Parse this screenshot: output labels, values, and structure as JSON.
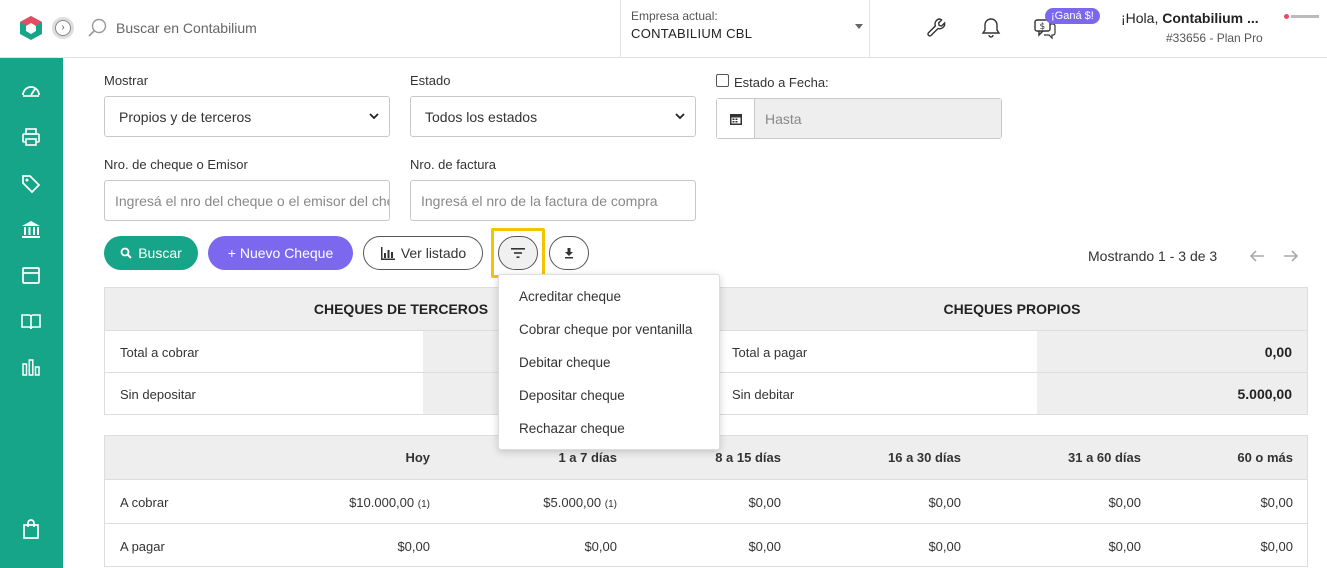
{
  "topbar": {
    "search_placeholder": "Buscar en Contabilium",
    "company_label": "Empresa actual:",
    "company_value": "CONTABILIUM CBL",
    "promo_badge": "¡Ganá $!",
    "greeting_prefix": "¡Hola, ",
    "greeting_name": "Contabilium ...",
    "plan": "#33656 - Plan Pro"
  },
  "sidebar": {
    "icons": [
      "dashboard-icon",
      "printer-icon",
      "tag-icon",
      "bank-icon",
      "box-icon",
      "book-icon",
      "bar-chart-icon",
      "shopping-bag-icon"
    ],
    "color": "#17a589"
  },
  "filters": {
    "mostrar_label": "Mostrar",
    "mostrar_value": "Propios y de terceros",
    "estado_label": "Estado",
    "estado_value": "Todos los estados",
    "estado_fecha_label": "Estado a Fecha:",
    "hasta_placeholder": "Hasta",
    "cheque_label": "Nro. de cheque o Emisor",
    "cheque_placeholder": "Ingresá el nro del cheque o el emisor del cheque",
    "factura_label": "Nro. de factura",
    "factura_placeholder": "Ingresá el nro de la factura de compra"
  },
  "actions": {
    "buscar": "Buscar",
    "nuevo": "+ Nuevo Cheque",
    "ver_listado": "Ver listado",
    "pager": "Mostrando 1 - 3 de 3"
  },
  "dropdown": {
    "items": [
      "Acreditar cheque",
      "Cobrar cheque por ventanilla",
      "Debitar cheque",
      "Depositar cheque",
      "Rechazar cheque"
    ]
  },
  "summary": {
    "terceros_title": "CHEQUES DE TERCEROS",
    "propios_title": "CHEQUES PROPIOS",
    "terceros_rows": [
      {
        "label": "Total a cobrar",
        "value": ""
      },
      {
        "label": "Sin depositar",
        "value": ""
      }
    ],
    "propios_rows": [
      {
        "label": "Total a pagar",
        "value": "0,00"
      },
      {
        "label": "Sin debitar",
        "value": "5.000,00"
      }
    ]
  },
  "aging": {
    "headers": [
      "Hoy",
      "1 a 7 días",
      "8 a 15 días",
      "16 a 30 días",
      "31 a 60 días",
      "60 o más"
    ],
    "rows": [
      {
        "label": "A cobrar",
        "cells": [
          "$10.000,00",
          "$5.000,00",
          "$0,00",
          "$0,00",
          "$0,00",
          "$0,00"
        ],
        "notes": [
          "(1)",
          "(1)",
          "",
          "",
          "",
          ""
        ]
      },
      {
        "label": "A pagar",
        "cells": [
          "$0,00",
          "$0,00",
          "$0,00",
          "$0,00",
          "$0,00",
          "$0,00"
        ],
        "notes": [
          "",
          "",
          "",
          "",
          "",
          ""
        ]
      }
    ]
  },
  "colors": {
    "accent_green": "#17a589",
    "accent_purple": "#7b68ee",
    "highlight": "#f2c500"
  }
}
